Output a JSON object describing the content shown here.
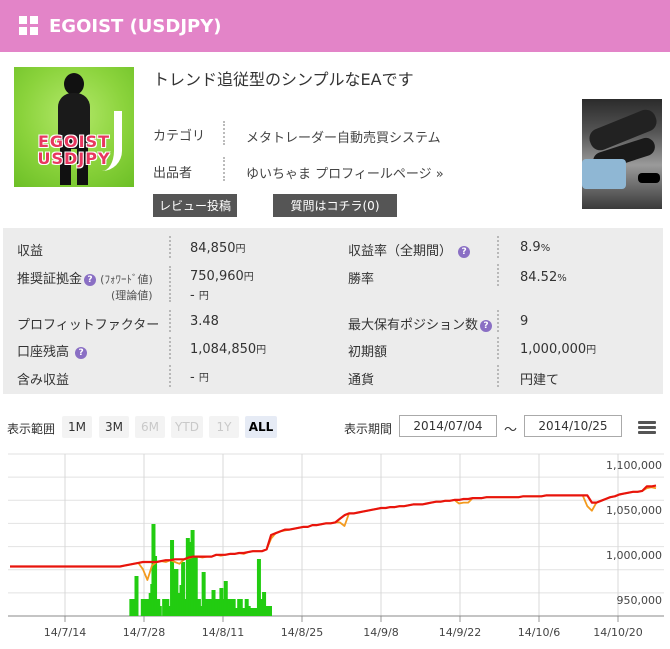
{
  "header": {
    "title": "EGOIST (USDJPY)"
  },
  "product": {
    "logo_text_line1": "EGOIST",
    "logo_text_line2": "USDJPY",
    "tagline": "トレンド追従型のシンプルなEAです",
    "category_label": "カテゴリ",
    "category_value": "メタトレーダー自動売買システム",
    "seller_label": "出品者",
    "seller_value": "ゆいちゃま プロフィールページ »"
  },
  "buttons": {
    "review": "レビュー投稿",
    "question": "質問はコチラ(0)"
  },
  "stats": {
    "profit_label": "収益",
    "profit_value": "84,850",
    "profit_rate_label": "収益率（全期間）",
    "profit_rate_value": "8.9",
    "margin_label": "推奨証拠金",
    "margin_forward_label": "(ﾌｫﾜｰﾄﾞ値)",
    "margin_theory_label": "(理論値)",
    "margin_forward_value": "750,960",
    "margin_theory_value": "-",
    "winrate_label": "勝率",
    "winrate_value": "84.52",
    "pf_label": "プロフィットファクター",
    "pf_value": "3.48",
    "maxpos_label": "最大保有ポジション数",
    "maxpos_value": "9",
    "balance_label": "口座残高",
    "balance_value": "1,084,850",
    "initial_label": "初期額",
    "initial_value": "1,000,000",
    "unrealized_label": "含み収益",
    "unrealized_value": "-",
    "currency_label": "通貨",
    "currency_value": "円建て",
    "yen": "円",
    "percent": "%",
    "help": "?"
  },
  "range": {
    "label": "表示範囲",
    "buttons": [
      "1M",
      "3M",
      "6M",
      "YTD",
      "1Y",
      "ALL"
    ],
    "period_label": "表示期間",
    "from": "2014/07/04",
    "to": "2014/10/25",
    "tilde": "～"
  },
  "chart_data": {
    "type": "line",
    "x_tick_labels": [
      "14/7/14",
      "14/7/28",
      "14/8/11",
      "14/8/25",
      "14/9/8",
      "14/9/22",
      "14/10/6",
      "14/10/20"
    ],
    "y_tick_labels": [
      "1,100,000",
      "1,050,000",
      "1,000,000",
      "950,000"
    ],
    "ylim": [
      940000,
      1120000
    ],
    "grid": true,
    "colors": {
      "balance": "#e8140c",
      "equity": "#f39a1e",
      "bars": "#22cc11"
    },
    "series": [
      {
        "values": [
          995000,
          995000,
          995000,
          995000,
          995000,
          995000,
          995000,
          995000,
          995000,
          995000,
          995000,
          995000,
          995000,
          995000,
          995000,
          995000,
          995000,
          995000,
          995000,
          995000,
          995000,
          995000,
          995000,
          995000,
          995000,
          996000,
          997000,
          998000,
          999000,
          1000000,
          1000000,
          1000000,
          1000000,
          1001000,
          1002000,
          1002000,
          1003000,
          1003000,
          1003000,
          1005000,
          1006000,
          1006000,
          1006000,
          1006000,
          1006000,
          1008000,
          1008000,
          1008000,
          1009000,
          1009000,
          1010000,
          1010000,
          1011000,
          1012000,
          1012000,
          1012000,
          1014000,
          1030000,
          1032000,
          1034000,
          1036000,
          1036000,
          1037000,
          1038000,
          1039000,
          1039000,
          1041000,
          1041000,
          1042000,
          1043000,
          1043000,
          1044000,
          1048000,
          1052000,
          1054000,
          1054000,
          1055000,
          1056000,
          1057000,
          1058000,
          1059000,
          1060000,
          1060000,
          1061000,
          1061000,
          1062000,
          1062000,
          1063000,
          1064000,
          1064000,
          1064000,
          1065000,
          1066000,
          1067000,
          1067000,
          1068000,
          1068000,
          1069000,
          1069000,
          1070000,
          1070000,
          1071000,
          1071000,
          1071000,
          1072000,
          1072000,
          1072000,
          1072000,
          1072000,
          1072000,
          1072000,
          1072000,
          1073000,
          1073000,
          1073000,
          1073000,
          1073000,
          1074000,
          1074000,
          1074000,
          1074000,
          1074000,
          1074000,
          1074000,
          1074000,
          1074000,
          1074000,
          1066000,
          1066000,
          1068000,
          1070000,
          1072000,
          1073000,
          1075000,
          1076000,
          1077000,
          1078000,
          1078000,
          1079000,
          1084000,
          1084000,
          1084850
        ]
      },
      {
        "values": [
          995000,
          995000,
          995000,
          995000,
          995000,
          995000,
          995000,
          995000,
          995000,
          995000,
          995000,
          995000,
          995000,
          995000,
          995000,
          995000,
          995000,
          995000,
          995000,
          995000,
          995000,
          995000,
          995000,
          995000,
          995000,
          996000,
          997000,
          998000,
          999000,
          992000,
          980000,
          996000,
          1000000,
          1001000,
          1000000,
          1002000,
          1000000,
          998000,
          1003000,
          1004000,
          1006000,
          1006000,
          1005000,
          1006000,
          1006000,
          1008000,
          1007000,
          1008000,
          1009000,
          1009000,
          1010000,
          1009000,
          1011000,
          1012000,
          1012000,
          1012000,
          1014000,
          1026000,
          1032000,
          1034000,
          1035000,
          1036000,
          1037000,
          1038000,
          1039000,
          1039000,
          1041000,
          1041000,
          1042000,
          1043000,
          1043000,
          1044000,
          1044000,
          1040000,
          1054000,
          1054000,
          1055000,
          1056000,
          1057000,
          1058000,
          1059000,
          1060000,
          1060000,
          1061000,
          1061000,
          1062000,
          1062000,
          1063000,
          1064000,
          1064000,
          1064000,
          1065000,
          1066000,
          1067000,
          1067000,
          1068000,
          1068000,
          1069000,
          1065000,
          1066000,
          1066000,
          1071000,
          1071000,
          1071000,
          1072000,
          1072000,
          1072000,
          1072000,
          1072000,
          1072000,
          1072000,
          1072000,
          1073000,
          1073000,
          1073000,
          1073000,
          1073000,
          1074000,
          1074000,
          1074000,
          1074000,
          1074000,
          1074000,
          1074000,
          1074000,
          1074000,
          1062000,
          1057000,
          1066000,
          1068000,
          1070000,
          1072000,
          1073000,
          1075000,
          1076000,
          1077000,
          1078000,
          1078000,
          1079000,
          1082000,
          1083000,
          1082000
        ]
      }
    ],
    "bars": {
      "t": [
        0.245,
        0.28,
        0.31,
        0.39,
        0.41,
        0.43,
        0.45,
        0.47,
        0.49,
        0.51,
        0.525,
        0.545,
        0.565,
        0.585,
        0.605,
        0.66,
        0.68,
        0.7,
        0.72,
        0.735,
        0.76,
        0.77,
        0.79,
        0.815,
        0.845,
        0.865,
        0.88,
        0.9,
        0.925,
        0.945,
        0.96,
        0.99,
        1.02,
        1.06,
        1.08,
        1.1,
        1.12,
        1.14,
        1.16,
        1.18,
        1.205,
        1.23,
        1.255,
        1.285,
        1.325,
        1.355,
        1.385,
        1.41,
        1.44,
        1.47,
        1.49,
        1.515,
        1.54,
        1.57,
        1.61,
        1.63,
        1.66,
        1.705,
        1.73,
        1.75,
        1.775,
        1.8,
        1.82,
        1.86,
        1.89,
        1.925,
        1.96,
        2.0
      ],
      "heights": [
        17,
        17,
        40,
        17,
        17,
        17,
        17,
        17,
        23,
        32,
        92,
        60,
        15,
        17,
        10,
        17,
        17,
        17,
        10,
        8,
        76,
        17,
        47,
        47,
        23,
        17,
        31,
        54,
        17,
        10,
        78,
        74,
        86,
        60,
        17,
        17,
        10,
        10,
        44,
        17,
        17,
        17,
        17,
        26,
        17,
        17,
        28,
        17,
        35,
        17,
        17,
        17,
        17,
        8,
        17,
        17,
        8,
        17,
        10,
        8,
        8,
        8,
        8,
        57,
        17,
        24,
        10,
        10
      ]
    }
  }
}
